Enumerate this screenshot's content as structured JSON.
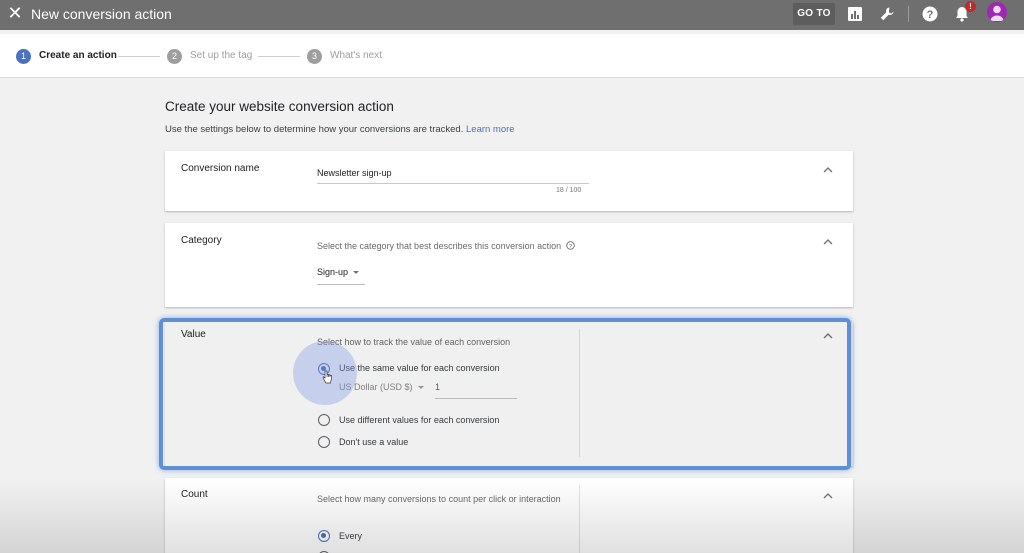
{
  "topbar": {
    "title": "New conversion action",
    "goto_label": "GO TO",
    "notification_count": "!"
  },
  "stepper": {
    "steps": [
      {
        "number": "1",
        "label": "Create an action",
        "active": true
      },
      {
        "number": "2",
        "label": "Set up the tag",
        "active": false
      },
      {
        "number": "3",
        "label": "What's next",
        "active": false
      }
    ]
  },
  "main": {
    "title": "Create your website conversion action",
    "subtitle": "Use the settings below to determine how your conversions are tracked.",
    "learn_more": "Learn more"
  },
  "sections": {
    "conversion_name": {
      "label": "Conversion name",
      "value": "Newsletter sign-up",
      "counter": "18 / 100"
    },
    "category": {
      "label": "Category",
      "hint": "Select the category that best describes this conversion action",
      "selected": "Sign-up"
    },
    "value": {
      "label": "Value",
      "hint": "Select how to track the value of each conversion",
      "options": [
        {
          "label": "Use the same value for each conversion",
          "selected": true
        },
        {
          "label": "Use different values for each conversion",
          "selected": false
        },
        {
          "label": "Don't use a value",
          "selected": false
        }
      ],
      "currency": "US Dollar (USD $)",
      "amount": "1"
    },
    "count": {
      "label": "Count",
      "hint": "Select how many conversions to count per click or interaction",
      "options": [
        {
          "label": "Every",
          "selected": true
        }
      ]
    }
  },
  "colors": {
    "accent": "#4a72c2",
    "topbar": "#6f6f6f",
    "highlight": "#5f8fd6",
    "avatar": "#9c27b0",
    "alert": "#c62828"
  }
}
